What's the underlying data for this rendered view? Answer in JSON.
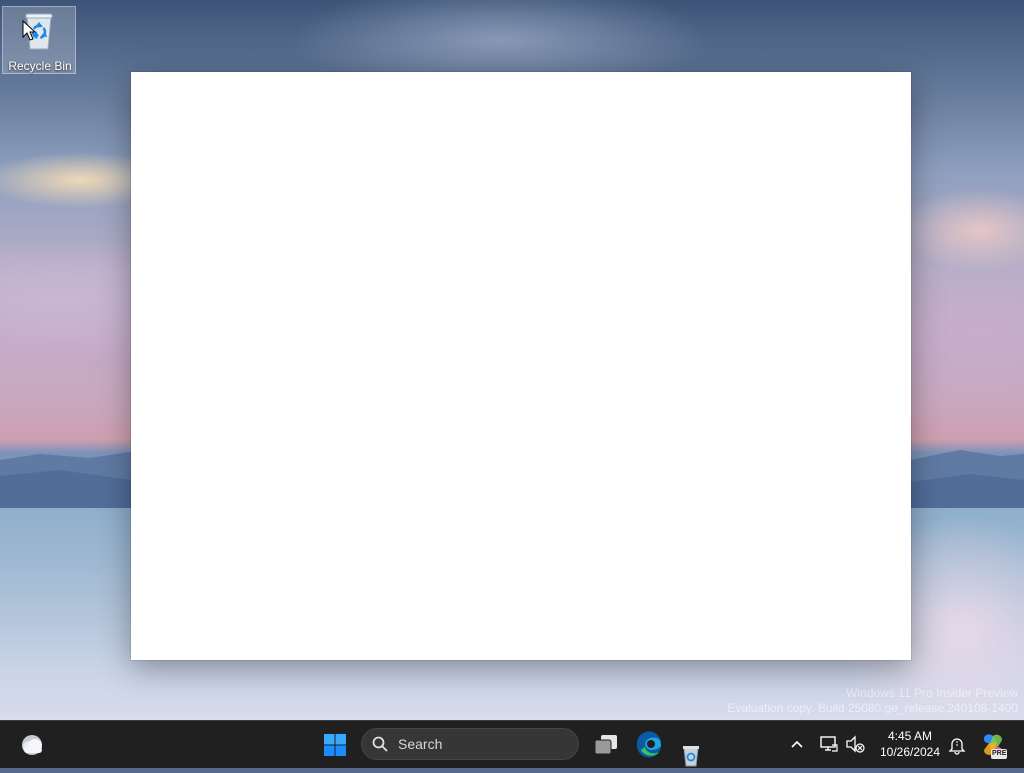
{
  "desktop": {
    "icons": [
      {
        "label": "Recycle Bin",
        "icon": "recycle-bin-icon"
      }
    ],
    "watermark": {
      "line1": "Windows 11 Pro Insider Preview",
      "line2": "Evaluation copy. Build 25080.ge_release.240108-1400"
    }
  },
  "window": {
    "title": "",
    "content": ""
  },
  "taskbar": {
    "search_placeholder": "Search",
    "pinned": [
      {
        "name": "weather-widget",
        "icon": "weather-icon"
      },
      {
        "name": "start",
        "icon": "windows-logo-icon"
      },
      {
        "name": "task-view",
        "icon": "task-view-icon"
      },
      {
        "name": "edge",
        "icon": "edge-icon"
      },
      {
        "name": "recycle-bin",
        "icon": "recycle-bin-icon"
      }
    ],
    "tray": {
      "chevron_glyph": "^",
      "time": "4:45 AM",
      "date": "10/26/2024",
      "copilot_badge": "PRE"
    }
  },
  "colors": {
    "taskbar_bg": "#202020",
    "accent_blue": "#1a8cff",
    "window_bg": "#ffffff"
  }
}
